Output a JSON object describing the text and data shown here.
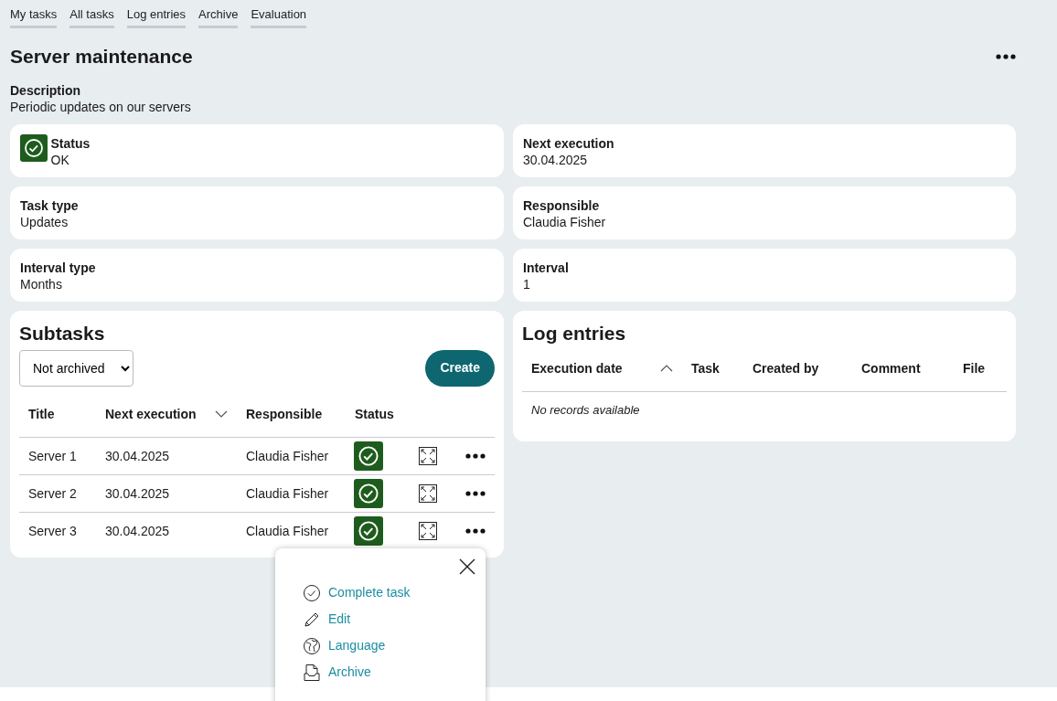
{
  "nav_links": [
    {
      "label": "My tasks"
    },
    {
      "label": "All tasks"
    },
    {
      "label": "Log entries"
    },
    {
      "label": "Archive"
    },
    {
      "label": "Evaluation"
    }
  ],
  "title": "Server maintenance",
  "description": {
    "label": "Description",
    "value": "Periodic updates on our servers"
  },
  "fields": [
    {
      "label": "Status",
      "value": "OK",
      "ok": true
    },
    {
      "label": "Next execution",
      "value": "30.04.2025"
    },
    {
      "label": "Task type",
      "value": "Updates"
    },
    {
      "label": "Responsible",
      "value": "Claudia Fisher"
    },
    {
      "label": "Interval type",
      "value": "Months"
    },
    {
      "label": "Interval",
      "value": "1"
    }
  ],
  "subtasks": {
    "title": "Subtasks",
    "filter": "Not archived",
    "create_button": "Create",
    "columns": [
      {
        "label": "Title"
      },
      {
        "label": "Next execution",
        "sorted": true,
        "descending": true
      },
      {
        "label": "Responsible"
      },
      {
        "label": "Status"
      }
    ],
    "rows": [
      {
        "title": "Server 1",
        "next_execution": "30.04.2025",
        "responsible": "Claudia Fisher",
        "ok": true
      },
      {
        "title": "Server 2",
        "next_execution": "30.04.2025",
        "responsible": "Claudia Fisher",
        "ok": true
      },
      {
        "title": "Server 3",
        "next_execution": "30.04.2025",
        "responsible": "Claudia Fisher",
        "ok": true
      }
    ]
  },
  "log_entries": {
    "title": "Log entries",
    "columns": [
      {
        "label": "Execution date",
        "sorted": true,
        "descending": false
      },
      {
        "label": "Task"
      },
      {
        "label": "Created by"
      },
      {
        "label": "Comment"
      },
      {
        "label": "File"
      }
    ],
    "empty_text": "No records available"
  },
  "context_menu": {
    "items": [
      {
        "label": "Complete task",
        "kind": "complete"
      },
      {
        "label": "Edit",
        "kind": "edit"
      },
      {
        "label": "Language",
        "kind": "language"
      },
      {
        "label": "Archive",
        "kind": "archive"
      }
    ]
  }
}
